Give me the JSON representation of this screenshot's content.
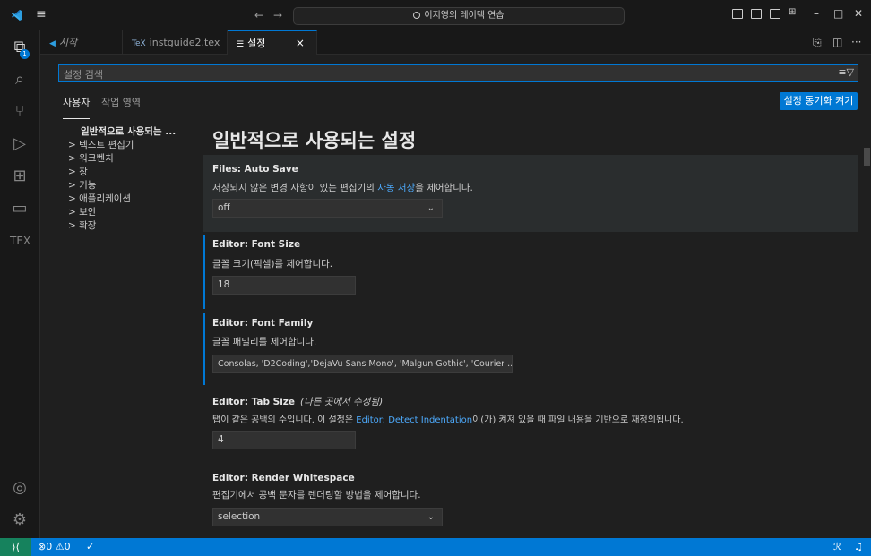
{
  "window": {
    "search_text": "이지영의 레이텍 연습"
  },
  "activity": {
    "explorer_badge": "1",
    "tex_label": "TEX"
  },
  "tabs": [
    {
      "label": "시작",
      "icon": "vscode-logo-icon"
    },
    {
      "label": "instguide2.tex",
      "icon": "tex-file-icon",
      "dirty": "●"
    },
    {
      "label": "설정",
      "icon": "settings-file-icon",
      "close": "×"
    }
  ],
  "settings": {
    "search_placeholder": "설정 검색",
    "scopes": [
      "사용자",
      "작업 영역"
    ],
    "sync_button": "설정 동기화 켜기",
    "toc": [
      "일반적으로 사용되는 ...",
      "> 텍스트 편집기",
      "> 워크벤치",
      "> 창",
      "> 기능",
      "> 애플리케이션",
      "> 보안",
      "> 확장"
    ],
    "section_title": "일반적으로 사용되는 설정",
    "items": [
      {
        "category": "Files: ",
        "name": "Auto Save",
        "desc_before": "저장되지 않은 변경 사항이 있는 편집기의 ",
        "desc_link": "자동 저장",
        "desc_after": "을 제어합니다.",
        "value": "off"
      },
      {
        "category": "Editor: ",
        "name": "Font Size",
        "desc": "글꼴 크기(픽셀)를 제어합니다.",
        "value": "18"
      },
      {
        "category": "Editor: ",
        "name": "Font Family",
        "desc": "글꼴 패밀리를 제어합니다.",
        "value": "Consolas, 'D2Coding','DejaVu Sans Mono', 'Malgun Gothic', 'Courier ..."
      },
      {
        "category": "Editor: ",
        "name": "Tab Size",
        "note": "(다른 곳에서 수정됨)",
        "desc_before": "탭이 같은 공백의 수입니다. 이 설정은 ",
        "desc_link": "Editor: Detect Indentation",
        "desc_after": "이(가) 켜져 있을 때 파일 내용을 기반으로 재정의됩니다.",
        "value": "4"
      },
      {
        "category": "Editor: ",
        "name": "Render Whitespace",
        "desc": "편집기에서 공백 문자를 렌더링할 방법을 제어합니다.",
        "value": "selection"
      }
    ]
  },
  "status": {
    "errors": "0",
    "warnings": "0"
  },
  "colors": {
    "accent": "#0078d4",
    "remote": "#16825d",
    "link": "#4daafc"
  }
}
